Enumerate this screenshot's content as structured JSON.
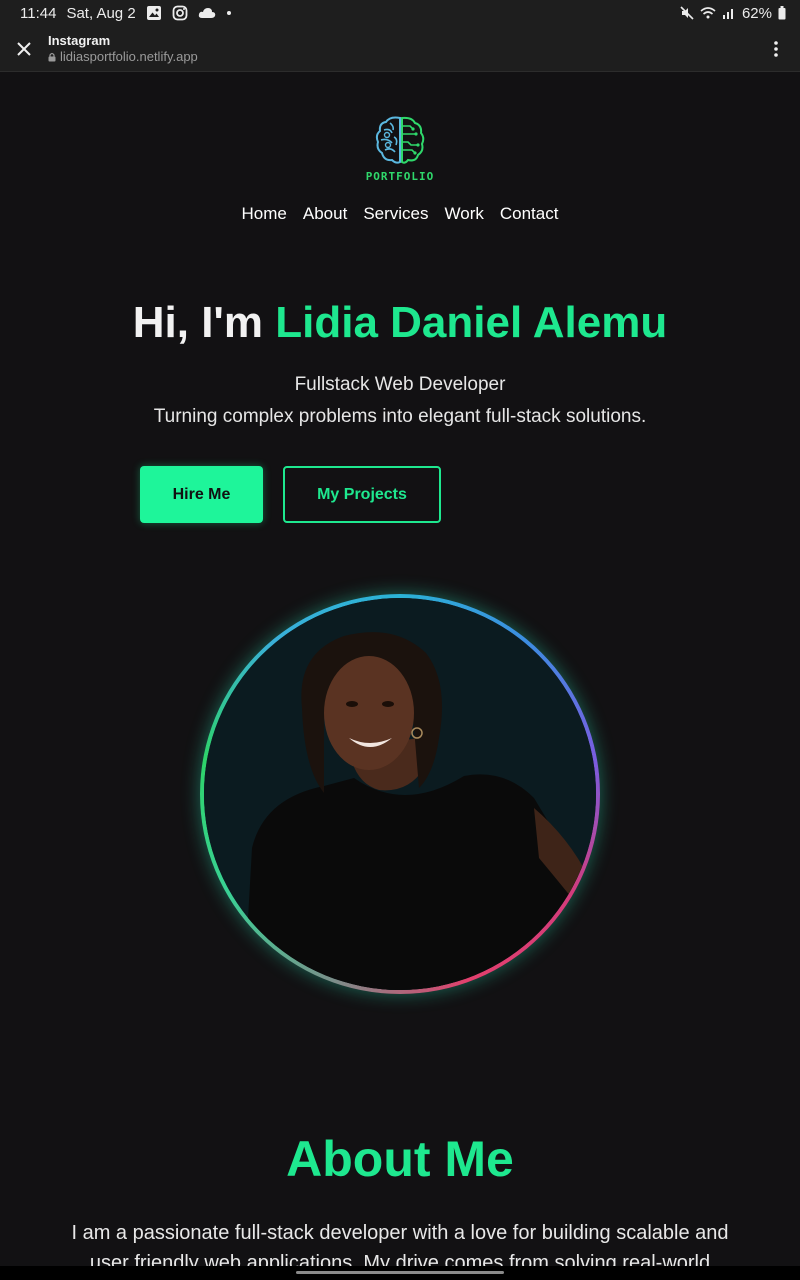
{
  "status_bar": {
    "time": "11:44",
    "date": "Sat, Aug 2",
    "battery": "62%",
    "icons": [
      "gallery-icon",
      "instagram-icon",
      "cloud-icon",
      "dot-icon",
      "mute-icon",
      "wifi-icon",
      "signal-icon",
      "battery-icon"
    ]
  },
  "browser": {
    "title": "Instagram",
    "url": "lidiasportfolio.netlify.app",
    "icons": [
      "close-icon",
      "lock-icon",
      "more-vert-icon"
    ]
  },
  "logo": {
    "text": "PORTFOLIO",
    "icon": "brain-circuit-logo"
  },
  "nav": {
    "items": [
      {
        "label": "Home"
      },
      {
        "label": "About"
      },
      {
        "label": "Services"
      },
      {
        "label": "Work"
      },
      {
        "label": "Contact"
      }
    ]
  },
  "hero": {
    "greeting": "Hi, I'm ",
    "name": "Lidia Daniel Alemu",
    "role": "Fullstack Web Developer",
    "tagline": "Turning complex problems into elegant full-stack solutions.",
    "hire_label": "Hire Me",
    "projects_label": "My Projects"
  },
  "about": {
    "title": "About Me",
    "text": "I am a passionate full-stack developer with a love for building scalable and user friendly web applications. My drive comes from solving real-world problems"
  },
  "colors": {
    "accent": "#1ee88f",
    "background": "#121113",
    "button_fill": "#1ef59a",
    "logo_green": "#2fd86b",
    "logo_blue": "#5bb8e0"
  }
}
